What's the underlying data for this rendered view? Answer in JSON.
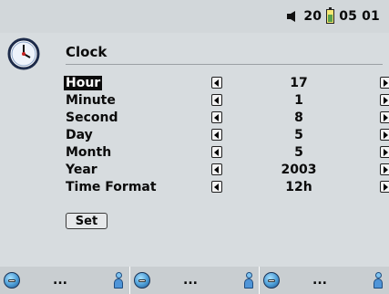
{
  "status": {
    "volume": "20",
    "time_hour": "05",
    "time_minute": "01"
  },
  "header": {
    "title": "Clock"
  },
  "settings": [
    {
      "label": "Hour",
      "value": "17",
      "selected": true
    },
    {
      "label": "Minute",
      "value": "1"
    },
    {
      "label": "Second",
      "value": "8"
    },
    {
      "label": "Day",
      "value": "5"
    },
    {
      "label": "Month",
      "value": "5"
    },
    {
      "label": "Year",
      "value": "2003"
    },
    {
      "label": "Time Format",
      "value": "12h"
    }
  ],
  "actions": {
    "set_label": "Set"
  },
  "bottom_bar": {
    "slots": [
      {
        "icon": "globe-icon",
        "text": "...",
        "user_icon": "user-icon"
      },
      {
        "icon": "globe-icon",
        "text": "...",
        "user_icon": "user-icon"
      },
      {
        "icon": "globe-icon",
        "text": "...",
        "user_icon": "user-icon"
      }
    ]
  },
  "colors": {
    "background": "#d7dcdf",
    "selection": "#0b0b0b",
    "battery_level": "#5ba04c"
  }
}
